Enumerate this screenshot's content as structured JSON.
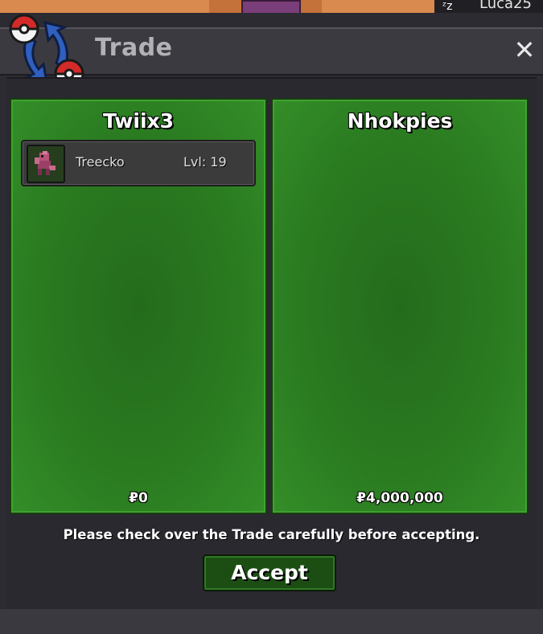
{
  "world": {
    "player_tag": "Luca25"
  },
  "window": {
    "title": "Trade",
    "close_glyph": "✕"
  },
  "trade": {
    "left": {
      "player_name": "Twiix3",
      "money": "₽0",
      "pokemon": [
        {
          "name": "Treecko",
          "level": "Lvl: 19"
        }
      ]
    },
    "right": {
      "player_name": "Nhokpies",
      "money": "₽4,000,000",
      "pokemon": []
    },
    "notice": "Please check over the Trade carefully before accepting.",
    "accept_label": "Accept"
  },
  "colors": {
    "panel_green": "#2a7a20",
    "accept_green": "#1c4e14",
    "window_dark": "#2c2b32"
  }
}
